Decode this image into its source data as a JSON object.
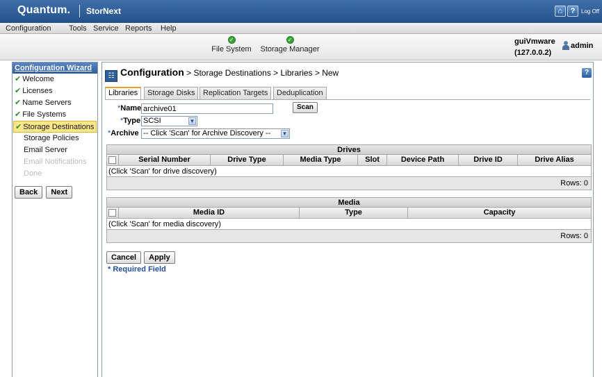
{
  "brand": {
    "name": "Quantum.",
    "product": "StorNext",
    "logoff": "Log Off"
  },
  "menu": [
    "Configuration",
    "Tools",
    "Service",
    "Reports",
    "Help"
  ],
  "status": [
    {
      "label": "File System"
    },
    {
      "label": "Storage Manager"
    }
  ],
  "server": {
    "name": "guiVmware",
    "ip": "(127.0.0.2)"
  },
  "user": {
    "name": "admin"
  },
  "wizard": {
    "title": "Configuration Wizard",
    "items": [
      {
        "label": "Welcome",
        "check": "✔"
      },
      {
        "label": "Licenses",
        "check": "✔"
      },
      {
        "label": "Name Servers",
        "check": "✔"
      },
      {
        "label": "File Systems",
        "check": "✔"
      },
      {
        "label": "Storage Destinations",
        "check": "✔"
      },
      {
        "label": "Storage Policies"
      },
      {
        "label": "Email Server"
      },
      {
        "label": "Email Notifications"
      },
      {
        "label": "Done"
      }
    ],
    "back_label": "Back",
    "next_label": "Next"
  },
  "page": {
    "title": "Configuration",
    "breadcrumb": " > Storage Destinations > Libraries > New",
    "help": "?"
  },
  "tabs": [
    "Libraries",
    "Storage Disks",
    "Replication Targets",
    "Deduplication"
  ],
  "form": {
    "name_label": "Name",
    "name_value": "archive01",
    "type_label": "Type",
    "type_value": "SCSI",
    "archive_label": "Archive",
    "archive_value": "-- Click 'Scan' for Archive Discovery --",
    "required_mark": "*",
    "scan_label": "Scan"
  },
  "drives": {
    "title": "Drives",
    "columns": [
      "Serial Number",
      "Drive Type",
      "Media Type",
      "Slot",
      "Device Path",
      "Drive ID",
      "Drive Alias"
    ],
    "message": "(Click 'Scan' for drive discovery)",
    "rows": "Rows: 0"
  },
  "media": {
    "title": "Media",
    "columns": [
      "Media ID",
      "Type",
      "Capacity"
    ],
    "message": "(Click 'Scan' for media discovery)",
    "rows": "Rows: 0"
  },
  "actions": {
    "cancel_label": "Cancel",
    "apply_label": "Apply",
    "required_note": "* Required Field"
  }
}
